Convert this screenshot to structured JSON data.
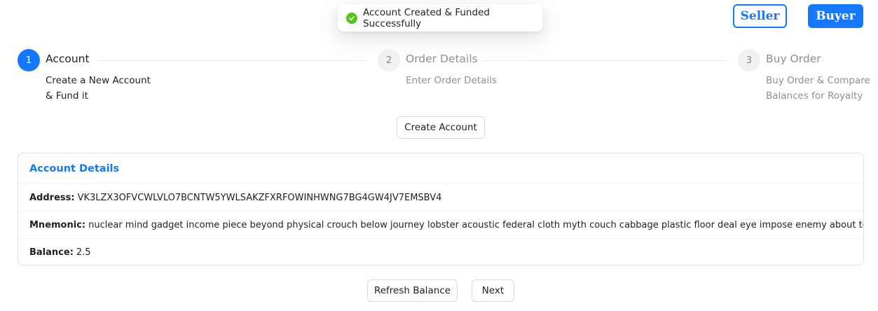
{
  "toast": {
    "message": "Account Created & Funded Successfully",
    "status_color": "#52c41a",
    "icon": "check-circle-icon"
  },
  "roles": {
    "seller_label": "Seller",
    "buyer_label": "Buyer"
  },
  "steps": [
    {
      "number": "1",
      "title": "Account",
      "description": "Create a New Account & Fund it",
      "status": "active"
    },
    {
      "number": "2",
      "title": "Order Details",
      "description": "Enter Order Details",
      "status": "wait"
    },
    {
      "number": "3",
      "title": "Buy Order",
      "description": "Buy Order & Compare Balances for Royalty",
      "status": "wait"
    }
  ],
  "actions": {
    "create_account": "Create Account",
    "refresh_balance": "Refresh Balance",
    "next": "Next"
  },
  "account": {
    "heading": "Account Details",
    "address_label": "Address:",
    "address_value": "VK3LZX3OFVCWLVLO7BCNTW5YWLSAKZFXRFOWINHWNG7BG4GW4JV7EMSBV4",
    "mnemonic_label": "Mnemonic:",
    "mnemonic_value": "nuclear mind gadget income piece beyond physical crouch below journey lobster acoustic federal cloth myth couch cabbage plastic floor deal eye impose enemy about today",
    "balance_label": "Balance:",
    "balance_value": "2.5"
  },
  "colors": {
    "primary": "#1677ff"
  }
}
